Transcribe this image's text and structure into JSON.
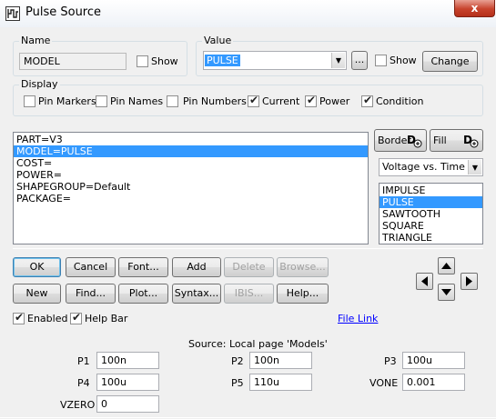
{
  "window": {
    "title": "Pulse Source",
    "close_glyph": "x"
  },
  "name_group": {
    "legend": "Name",
    "value": "MODEL",
    "show_label": "Show",
    "show_checked": false
  },
  "value_group": {
    "legend": "Value",
    "value": "PULSE",
    "ellipsis_label": "...",
    "show_label": "Show",
    "show_checked": false,
    "change_label": "Change"
  },
  "display_group": {
    "legend": "Display",
    "options": [
      {
        "label": "Pin Markers",
        "checked": false
      },
      {
        "label": "Pin Names",
        "checked": false
      },
      {
        "label": "Pin Numbers",
        "checked": false
      },
      {
        "label": "Current",
        "checked": true
      },
      {
        "label": "Power",
        "checked": true
      },
      {
        "label": "Condition",
        "checked": true
      }
    ]
  },
  "attributes": {
    "rows": [
      "PART=V3",
      "MODEL=PULSE",
      "COST=",
      "POWER=",
      "SHAPEGROUP=Default",
      "PACKAGE="
    ],
    "selected_index": 1
  },
  "border_button": {
    "label": "Border",
    "icon": "font-pen-icon"
  },
  "fill_button": {
    "label": "Fill",
    "icon": "font-pen-icon"
  },
  "plot_type": {
    "selected": "Voltage vs. Time"
  },
  "shapes": {
    "items": [
      "IMPULSE",
      "PULSE",
      "SAWTOOTH",
      "SQUARE",
      "TRIANGLE"
    ],
    "selected_index": 1
  },
  "buttons_row1": [
    {
      "label": "OK",
      "enabled": true
    },
    {
      "label": "Cancel",
      "enabled": true
    },
    {
      "label": "Font...",
      "enabled": true
    },
    {
      "label": "Add",
      "enabled": true
    },
    {
      "label": "Delete",
      "enabled": false
    },
    {
      "label": "Browse...",
      "enabled": false
    }
  ],
  "buttons_row2": [
    {
      "label": "New",
      "enabled": true
    },
    {
      "label": "Find...",
      "enabled": true
    },
    {
      "label": "Plot...",
      "enabled": true
    },
    {
      "label": "Syntax...",
      "enabled": true
    },
    {
      "label": "IBIS...",
      "enabled": false
    },
    {
      "label": "Help...",
      "enabled": true
    }
  ],
  "bottom_checks": [
    {
      "label": "Enabled",
      "checked": true
    },
    {
      "label": "Help Bar",
      "checked": true
    }
  ],
  "file_link": "File Link",
  "source_label": "Source: Local page 'Models'",
  "params": [
    {
      "name": "P1",
      "value": "100n"
    },
    {
      "name": "P2",
      "value": "100n"
    },
    {
      "name": "P3",
      "value": "100u"
    },
    {
      "name": "P4",
      "value": "100u"
    },
    {
      "name": "P5",
      "value": "110u"
    },
    {
      "name": "VONE",
      "value": "0.001"
    },
    {
      "name": "VZERO",
      "value": "0"
    }
  ]
}
